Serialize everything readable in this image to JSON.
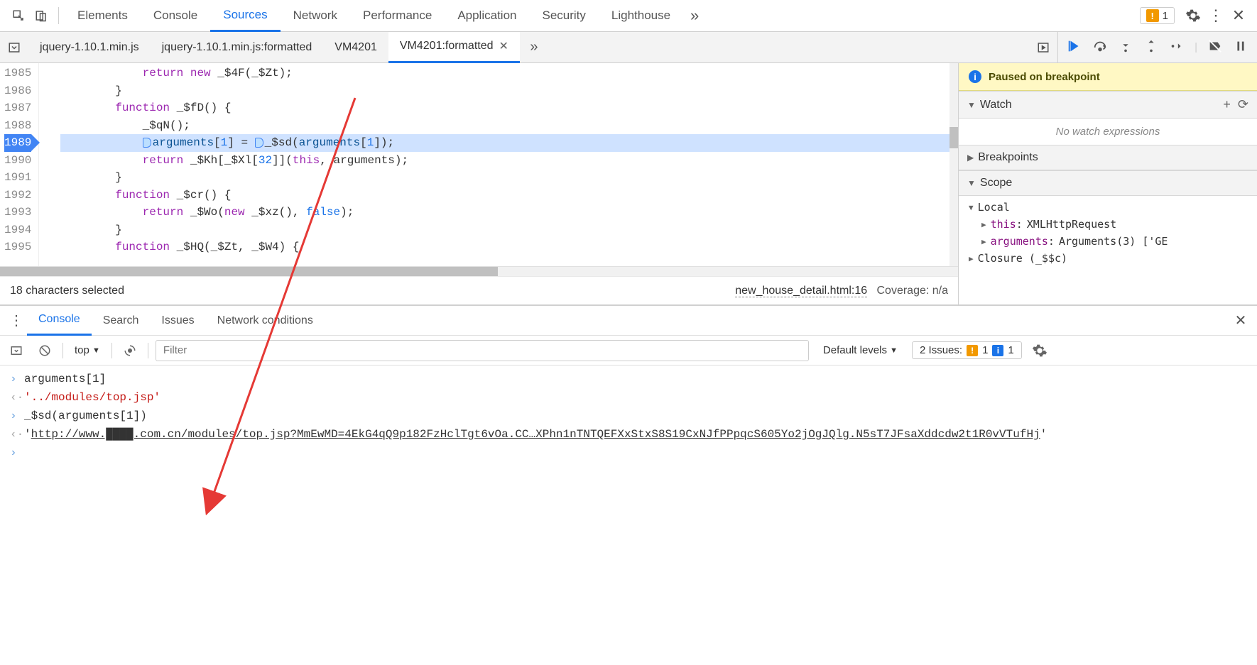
{
  "mainTabs": {
    "items": [
      "Elements",
      "Console",
      "Sources",
      "Network",
      "Performance",
      "Application",
      "Security",
      "Lighthouse"
    ],
    "activeIndex": 2,
    "issuesCount": "1"
  },
  "sourceTabs": {
    "items": [
      {
        "label": "jquery-1.10.1.min.js",
        "closable": false
      },
      {
        "label": "jquery-1.10.1.min.js:formatted",
        "closable": false
      },
      {
        "label": "VM4201",
        "closable": false
      },
      {
        "label": "VM4201:formatted",
        "closable": true
      }
    ],
    "activeIndex": 3
  },
  "code": {
    "startLine": 1985,
    "breakpointLine": 1989,
    "lines": [
      {
        "n": 1985,
        "html": "            <span class='kw'>return</span> <span class='kw'>new</span> _$4F(_$Zt);"
      },
      {
        "n": 1986,
        "html": "        }"
      },
      {
        "n": 1987,
        "html": "        <span class='kw'>function</span> _$fD() {"
      },
      {
        "n": 1988,
        "html": "            _$qN();"
      },
      {
        "n": 1989,
        "html": "            <span class='exec-marker'></span><span class='ident'>arguments</span>[<span class='num'>1</span>] = <span class='exec-marker'></span>_$sd(<span class='ident'>arguments</span>[<span class='num'>1</span>]);"
      },
      {
        "n": 1990,
        "html": "            <span class='kw'>return</span> _$Kh[_$Xl[<span class='num'>32</span>]](<span class='kw'>this</span>, arguments);"
      },
      {
        "n": 1991,
        "html": "        }"
      },
      {
        "n": 1992,
        "html": "        <span class='kw'>function</span> _$cr() {"
      },
      {
        "n": 1993,
        "html": "            <span class='kw'>return</span> _$Wo(<span class='kw'>new</span> _$xz(), <span class='bool'>false</span>);"
      },
      {
        "n": 1994,
        "html": "        }"
      },
      {
        "n": 1995,
        "html": "        <span class='kw'>function</span> _$HQ(_$Zt, _$W4) {"
      }
    ]
  },
  "codeStatus": {
    "selection": "18 characters selected",
    "sourceLink": "new_house_detail.html:16",
    "coverage": "Coverage: n/a"
  },
  "sidePane": {
    "pausedBanner": "Paused on breakpoint",
    "watch": {
      "title": "Watch",
      "empty": "No watch expressions"
    },
    "breakpoints": {
      "title": "Breakpoints"
    },
    "scope": {
      "title": "Scope",
      "local": "Local",
      "items": [
        {
          "key": "this",
          "val": "XMLHttpRequest"
        },
        {
          "key": "arguments",
          "val": "Arguments(3) ['GE"
        }
      ],
      "closure": "Closure (_$$c)"
    }
  },
  "drawer": {
    "tabs": [
      "Console",
      "Search",
      "Issues",
      "Network conditions"
    ],
    "activeIndex": 0
  },
  "consoleToolbar": {
    "context": "top",
    "filterPlaceholder": "Filter",
    "levels": "Default levels",
    "issuesLabel": "2 Issues:",
    "warnCount": "1",
    "infoCount": "1"
  },
  "consoleLines": [
    {
      "type": "input",
      "text": "arguments[1]"
    },
    {
      "type": "output",
      "text": "'../modules/top.jsp'"
    },
    {
      "type": "input",
      "text": "_$sd(arguments[1])"
    },
    {
      "type": "output-url",
      "prefix": "'",
      "url": "http://www.████.com.cn/modules/top.jsp?MmEwMD=4EkG4qQ9p182FzHclTgt6vOa.CC…XPhn1nTNTQEFXxStxS8S19CxNJfPPpqcS605Yo2jOgJQlg.N5sT7JFsaXddcdw2t1R0vVTufHj",
      "suffix": "'"
    }
  ]
}
